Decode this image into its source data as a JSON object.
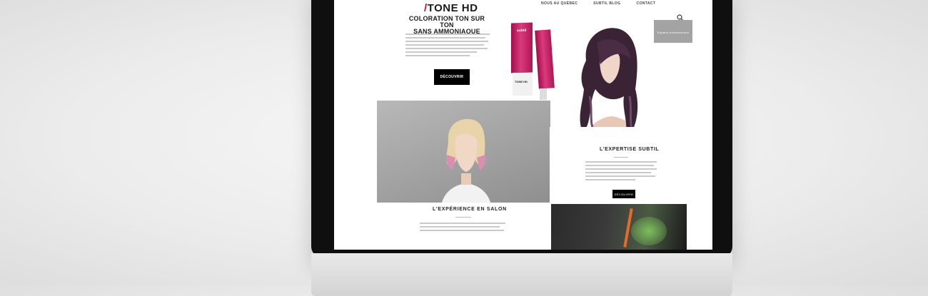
{
  "nav": {
    "links": [
      "Nous au Québec",
      "Subtil Blog",
      "Contact"
    ],
    "pro_label": "Espace professionnel"
  },
  "hero": {
    "brand_slash": "/",
    "brand_name": "TONE HD",
    "subtitle_line1": "COLORATION TON SUR TON",
    "subtitle_line2": "SANS AMMONIAQUE",
    "discover_label": "DÉCOUVRIR",
    "tube_brand": "subtil",
    "tube_label": "TONE HD"
  },
  "expert": {
    "title": "L'EXPERTISE SUBTIL",
    "button_label": "DÉCOUVRIR"
  },
  "salon": {
    "title": "L'EXPÉRIENCE EN SALON"
  },
  "device": {
    "logo_glyph": ""
  },
  "icons": {
    "search": "search-icon",
    "apple": "apple-logo"
  },
  "colors": {
    "accent": "#c8102e",
    "tube": "#b01552",
    "button": "#000000",
    "pro_area": "#a3a3a3"
  }
}
